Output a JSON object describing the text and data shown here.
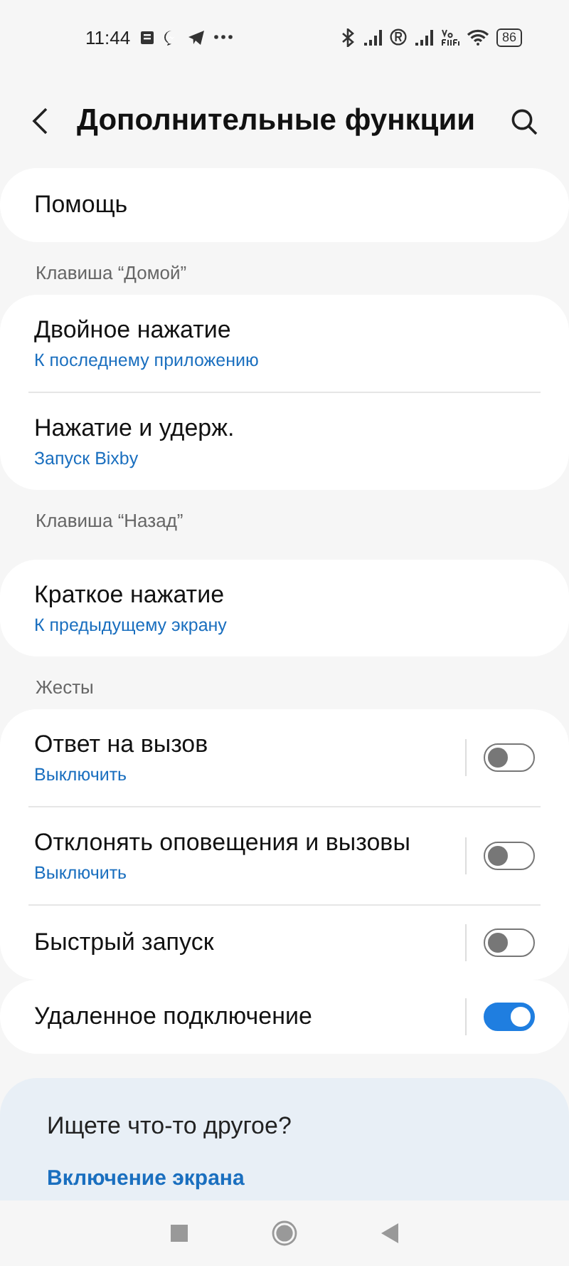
{
  "status_bar": {
    "time": "11:44",
    "battery": "86"
  },
  "header": {
    "title": "Дополнительные функции"
  },
  "groups": [
    {
      "rows": [
        {
          "kind": "link",
          "title": "Помощь"
        }
      ]
    },
    {
      "heading": "Клавиша “Домой”",
      "rows": [
        {
          "kind": "link",
          "title": "Двойное нажатие",
          "subtitle": "К последнему приложению"
        },
        {
          "kind": "link",
          "title": "Нажатие и удерж.",
          "subtitle": "Запуск Bixby"
        }
      ]
    },
    {
      "heading": "Клавиша “Назад”",
      "rows": [
        {
          "kind": "link",
          "title": "Краткое нажатие",
          "subtitle": "К предыдущему экрану"
        }
      ]
    },
    {
      "heading": "Жесты",
      "rows": [
        {
          "kind": "switch",
          "title": "Ответ на вызов",
          "subtitle": "Выключить",
          "on": false
        },
        {
          "kind": "switch",
          "title": "Отклонять оповещения и вызовы",
          "subtitle": "Выключить",
          "on": false
        },
        {
          "kind": "switch",
          "title": "Быстрый запуск",
          "on": false
        }
      ]
    },
    {
      "rows": [
        {
          "kind": "switch",
          "title": "Удаленное подключение",
          "on": true
        }
      ]
    }
  ],
  "suggestions": {
    "title": "Ищете что-то другое?",
    "links": [
      "Включение экрана"
    ]
  }
}
